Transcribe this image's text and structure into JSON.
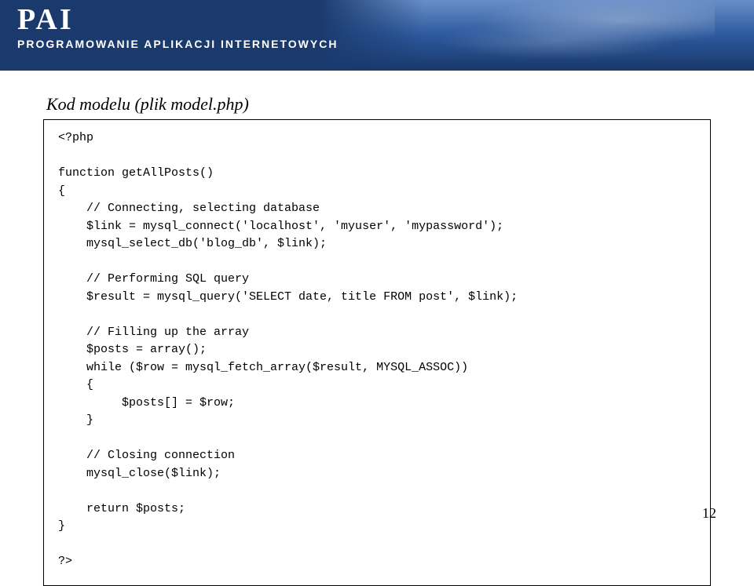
{
  "header": {
    "logo_main": "PAI",
    "logo_sub": "Programowanie Aplikacji Internetowych"
  },
  "page": {
    "title": "Kod  modelu (plik model.php)",
    "number": "12"
  },
  "code": {
    "l1": "<?php",
    "l2": "function getAllPosts()",
    "l3": "{",
    "l4": "    // Connecting, selecting database",
    "l5": "    $link = mysql_connect('localhost', 'myuser', 'mypassword');",
    "l6": "    mysql_select_db('blog_db', $link);",
    "l7": "    // Performing SQL query",
    "l8": "    $result = mysql_query('SELECT date, title FROM post', $link);",
    "l9": "    // Filling up the array",
    "l10": "    $posts = array();",
    "l11": "    while ($row = mysql_fetch_array($result, MYSQL_ASSOC))",
    "l12": "    {",
    "l13": "         $posts[] = $row;",
    "l14": "    }",
    "l15": "    // Closing connection",
    "l16": "    mysql_close($link);",
    "l17": "    return $posts;",
    "l18": "}",
    "l19": "?>"
  }
}
